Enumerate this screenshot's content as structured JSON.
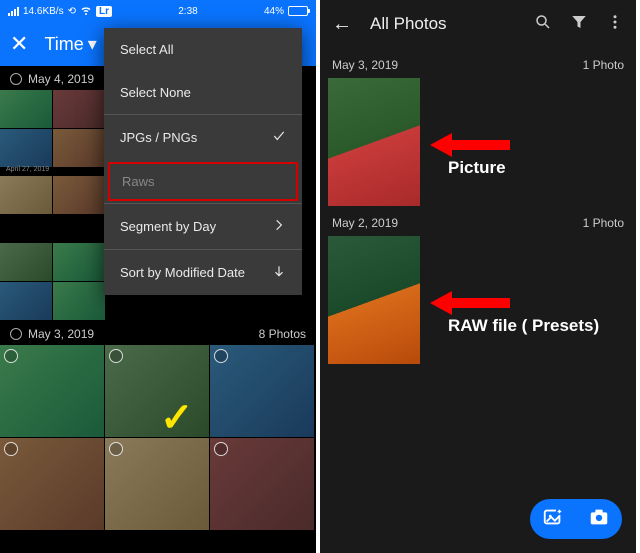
{
  "status": {
    "speed": "14.6KB/s",
    "app_badge": "Lr",
    "time": "2:38",
    "battery_pct": "44%"
  },
  "left": {
    "header_title": "Time",
    "menu": {
      "select_all": "Select All",
      "select_none": "Select None",
      "jpgs_pngs": "JPGs / PNGs",
      "raws": "Raws",
      "segment": "Segment by Day",
      "sort": "Sort by Modified Date"
    },
    "dates": {
      "may4": "May 4, 2019",
      "may3": "May 3, 2019",
      "apr27": "April 27, 2019"
    },
    "counts": {
      "may3_photos": "8 Photos"
    }
  },
  "right": {
    "title": "All Photos",
    "dates": {
      "may3": "May 3, 2019",
      "may2": "May 2, 2019"
    },
    "counts": {
      "one_photo": "1 Photo"
    },
    "labels": {
      "picture": "Picture",
      "raw": "RAW file ( Presets)"
    }
  }
}
